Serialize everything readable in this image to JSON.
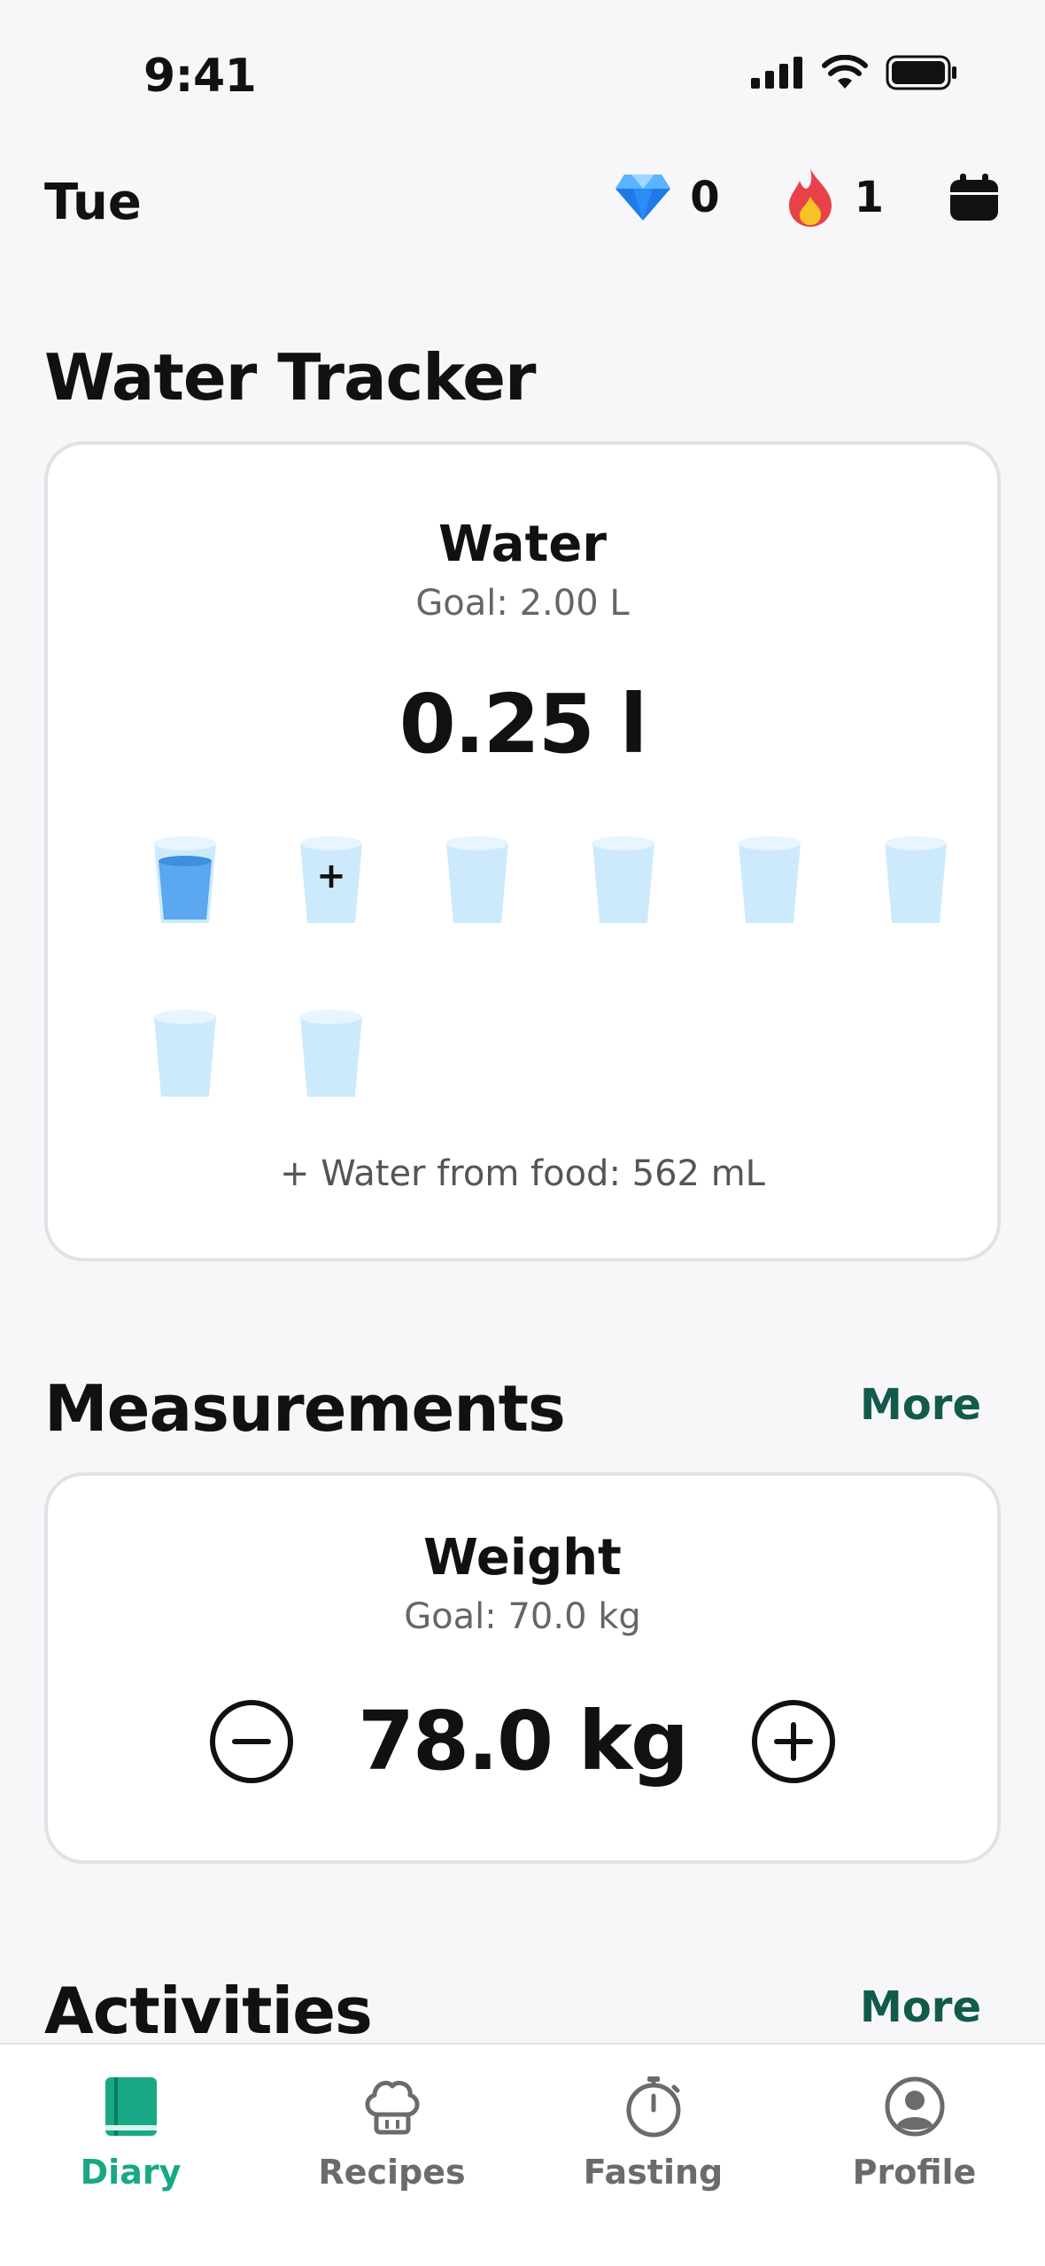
{
  "status": {
    "time": "9:41"
  },
  "header": {
    "day": "Tue",
    "gems": "0",
    "streak": "1"
  },
  "water": {
    "section_title": "Water Tracker",
    "card_title": "Water",
    "goal": "Goal: 2.00 L",
    "amount": "0.25 l",
    "glasses_total": 8,
    "glasses_filled": 1,
    "add_symbol": "+",
    "food_water": "+ Water from food: 562 mL"
  },
  "measurements": {
    "section_title": "Measurements",
    "more": "More",
    "card_title": "Weight",
    "goal": "Goal: 70.0 kg",
    "value": "78.0 kg"
  },
  "activities": {
    "section_title": "Activities",
    "more": "More"
  },
  "tabs": [
    {
      "label": "Diary",
      "icon": "book-icon",
      "active": true
    },
    {
      "label": "Recipes",
      "icon": "chef-hat-icon",
      "active": false
    },
    {
      "label": "Fasting",
      "icon": "stopwatch-icon",
      "active": false
    },
    {
      "label": "Profile",
      "icon": "user-icon",
      "active": false
    }
  ],
  "colors": {
    "accent": "#18a886",
    "more_link": "#125b4c",
    "water_fill": "#5ba7f0",
    "water_empty": "#cdeafd"
  }
}
